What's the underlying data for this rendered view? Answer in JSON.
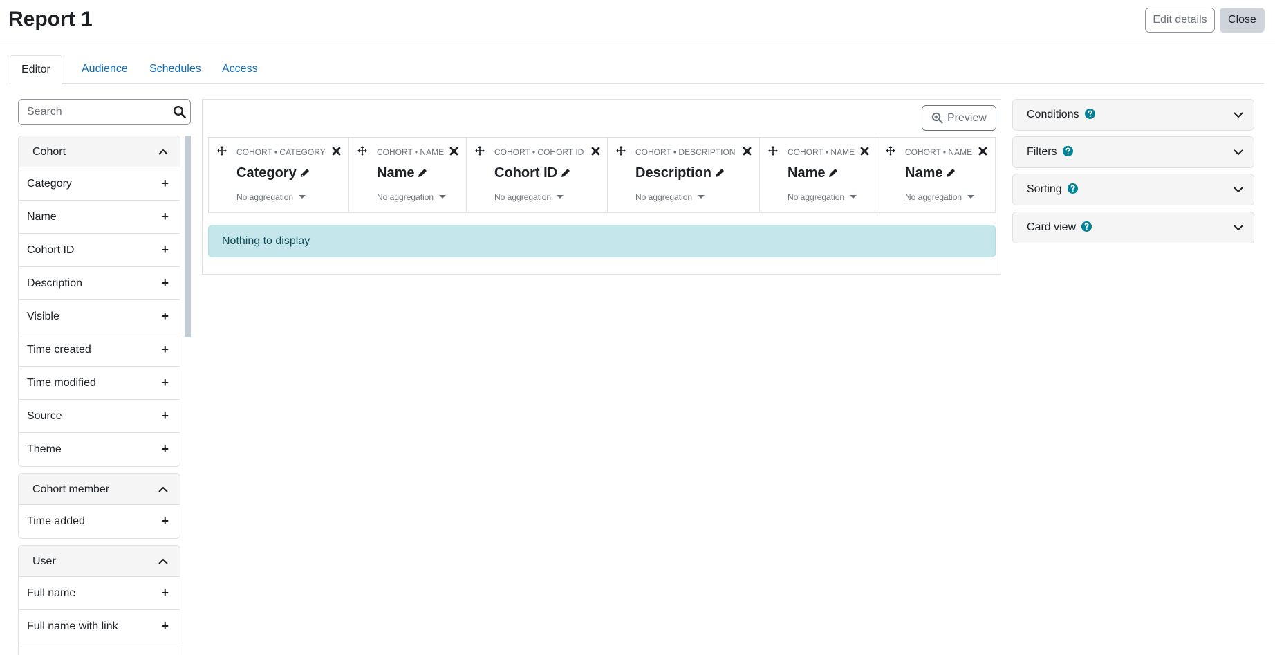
{
  "header": {
    "title": "Report 1",
    "edit_details_label": "Edit details",
    "close_label": "Close"
  },
  "tabs": [
    {
      "label": "Editor",
      "active": true
    },
    {
      "label": "Audience",
      "active": false
    },
    {
      "label": "Schedules",
      "active": false
    },
    {
      "label": "Access",
      "active": false
    }
  ],
  "sidebar": {
    "search_placeholder": "Search",
    "groups": [
      {
        "title": "Cohort",
        "items": [
          "Category",
          "Name",
          "Cohort ID",
          "Description",
          "Visible",
          "Time created",
          "Time modified",
          "Source",
          "Theme"
        ]
      },
      {
        "title": "Cohort member",
        "items": [
          "Time added"
        ]
      },
      {
        "title": "User",
        "items": [
          "Full name",
          "Full name with link"
        ]
      }
    ]
  },
  "main": {
    "preview_label": "Preview",
    "columns": [
      {
        "source": "COHORT • CATEGORY",
        "heading": "Category",
        "aggregation": "No aggregation"
      },
      {
        "source": "COHORT • NAME",
        "heading": "Name",
        "aggregation": "No aggregation"
      },
      {
        "source": "COHORT • COHORT ID",
        "heading": "Cohort ID",
        "aggregation": "No aggregation"
      },
      {
        "source": "COHORT • DESCRIPTION",
        "heading": "Description",
        "aggregation": "No aggregation"
      },
      {
        "source": "COHORT • NAME",
        "heading": "Name",
        "aggregation": "No aggregation"
      },
      {
        "source": "COHORT • NAME",
        "heading": "Name",
        "aggregation": "No aggregation"
      }
    ],
    "empty_message": "Nothing to display"
  },
  "right_panel": {
    "cards": [
      "Conditions",
      "Filters",
      "Sorting",
      "Card view"
    ]
  },
  "colors": {
    "link": "#0f6cbf",
    "info_bg": "#c5e6ea",
    "help": "#008196"
  }
}
